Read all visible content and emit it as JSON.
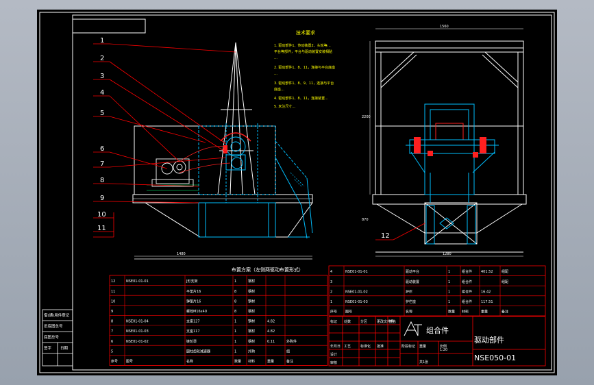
{
  "colors": {
    "background": "#000000",
    "frame": "#ffffff",
    "table": "#ff0000",
    "table_text": "#ffffff",
    "part": "#00bfff",
    "part_alt": "#6fc2ff",
    "notes": "#ffff00",
    "leader": "#ff0000",
    "motor": "#ff2020",
    "hatch": "#00b050"
  },
  "balloons": [
    "1",
    "2",
    "3",
    "4",
    "5",
    "6",
    "7",
    "8",
    "9",
    "10",
    "11"
  ],
  "balloon_right": "12",
  "section_title": "布置方案（左侧两驱动布置形式）",
  "notes_title": "技术要求",
  "notes": [
    "1. 驱动部件1、传动装置2、头轮等…",
    "   平台等部件，平台与驱动装置安装相贴",
    "   …",
    "2. 驱动部件1、8、11，连接与平台底座",
    "   …",
    "3. 驱动部件1、8、9、11，连接与平台",
    "   底座…",
    "4. 驱动部件1、8、11，连接装置…",
    "5. 未注尺寸…"
  ],
  "dim_labels": {
    "front_width": "1480",
    "front_height": "2200",
    "front_lower": "870",
    "side_width": "1560",
    "side_bottom": "1280"
  },
  "bom_left": [
    {
      "no": "12",
      "code": "NSE01-01-01",
      "name": "J形支架",
      "qty": "1",
      "mat": "钢材",
      "w": "",
      "note": ""
    },
    {
      "no": "11",
      "code": "",
      "name": "平垫片16",
      "qty": "8",
      "mat": "钢材",
      "w": "",
      "note": ""
    },
    {
      "no": "10",
      "code": "",
      "name": "弹垫片16",
      "qty": "8",
      "mat": "钢材",
      "w": "",
      "note": ""
    },
    {
      "no": "9",
      "code": "",
      "name": "螺栓M16x40",
      "qty": "8",
      "mat": "钢材",
      "w": "",
      "note": ""
    },
    {
      "no": "8",
      "code": "NSE01-01-04",
      "name": "支座127",
      "qty": "1",
      "mat": "钢材",
      "w": "4.82",
      "note": ""
    },
    {
      "no": "7",
      "code": "NSE01-01-03",
      "name": "支座117",
      "qty": "1",
      "mat": "钢材",
      "w": "4.82",
      "note": ""
    },
    {
      "no": "6",
      "code": "NSE01-01-02",
      "name": "链轮罩",
      "qty": "1",
      "mat": "钢材",
      "w": "0.11",
      "note": "外购件"
    },
    {
      "no": "5",
      "code": "",
      "name": "圆柱齿轮减速器",
      "qty": "1",
      "mat": "外购",
      "w": "",
      "note": "组"
    }
  ],
  "bom_left_header": {
    "no": "序号",
    "code": "图号",
    "name": "名称",
    "qty": "数量",
    "mat": "材料",
    "w": "重量",
    "note": "备注"
  },
  "bom_right": [
    {
      "no": "4",
      "code": "NSE01-01-01",
      "name": "驱动平台",
      "qty": "1",
      "mat": "组合件",
      "w": "401.52",
      "note": "组配"
    },
    {
      "no": "3",
      "code": "",
      "name": "驱动装置",
      "qty": "1",
      "mat": "组合件",
      "w": "",
      "note": "组配"
    },
    {
      "no": "2",
      "code": "NSE01-01-02",
      "name": "护栏",
      "qty": "1",
      "mat": "组合件",
      "w": "16.42",
      "note": ""
    },
    {
      "no": "1",
      "code": "NSE01-01-03",
      "name": "护栏座",
      "qty": "1",
      "mat": "组合件",
      "w": "117.51",
      "note": ""
    }
  ],
  "bom_right_header": {
    "no": "序号",
    "code": "图号",
    "name": "名称",
    "qty": "数量",
    "mat": "材料",
    "w": "重量",
    "note": "备注"
  },
  "title_block": {
    "logo_left": "组合件",
    "part_name": "驱动部件",
    "drawing_no": "NSE050-01",
    "scale": "1:20",
    "sheet": "共1张",
    "labels": [
      "标记",
      "处数",
      "分区",
      "更改文件号",
      "签名",
      "年月日",
      "设计",
      "审核",
      "工艺",
      "标准化",
      "批准",
      "阶段标记",
      "重量",
      "比例"
    ]
  },
  "left_strip": [
    "借(通)用件登记",
    "旧底图总号",
    "底图总号",
    "签字",
    "日期"
  ]
}
